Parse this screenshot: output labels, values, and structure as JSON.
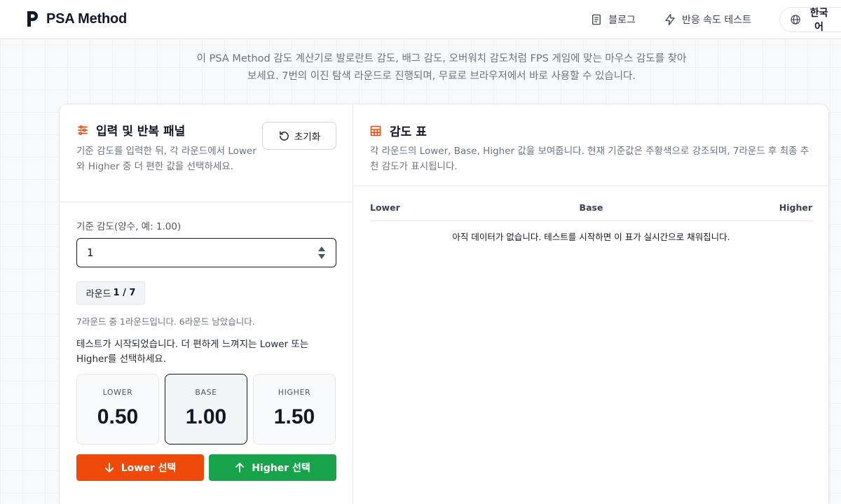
{
  "header": {
    "brand": "PSA Method",
    "nav": {
      "blog": "블로그",
      "reaction_test": "반응 속도 테스트",
      "language": "한국어"
    }
  },
  "intro": {
    "line1": "이 PSA Method 감도 계산기로 발로란트 감도, 배그 감도, 오버워치 감도처럼 FPS 게임에 맞는 마우스 감도를 찾아",
    "line2": "보세요. 7번의 이진 탐색 라운드로 진행되며, 무료로 브라우저에서 바로 사용할 수 있습니다."
  },
  "panel": {
    "title": "입력 및 반복 패널",
    "description": "기준 감도를 입력한 뒤, 각 라운드에서 Lower와 Higher 중 더 편한 값을 선택하세요.",
    "reset_label": "초기화",
    "input_label": "기준 감도(양수, 예: 1.00)",
    "input_value": "1",
    "round_prefix": "라운드",
    "round_value": "1 / 7",
    "round_info": "7라운드 중 1라운드입니다. 6라운드 남았습니다.",
    "status": "테스트가 시작되었습니다. 더 편하게 느껴지는 Lower 또는 Higher를 선택하세요.",
    "options": {
      "lower": {
        "label": "LOWER",
        "value": "0.50"
      },
      "base": {
        "label": "BASE",
        "value": "1.00"
      },
      "higher": {
        "label": "HIGHER",
        "value": "1.50"
      }
    },
    "choose_lower": "Lower 선택",
    "choose_higher": "Higher 선택"
  },
  "table": {
    "title": "감도 표",
    "description": "각 라운드의 Lower, Base, Higher 값을 보여줍니다. 현재 기준값은 주황색으로 강조되며, 7라운드 후 최종 추천 감도가 표시됩니다.",
    "columns": {
      "lower": "Lower",
      "base": "Base",
      "higher": "Higher"
    },
    "empty": "아직 데이터가 없습니다. 테스트를 시작하면 이 표가 실시간으로 채워집니다."
  },
  "colors": {
    "accent_orange": "#f04a0a",
    "accent_green": "#16a34a",
    "text_dark": "#111827",
    "text_muted": "#6b7280"
  },
  "icons": {
    "brand": "brand-p-logo-icon",
    "blog": "document-icon",
    "reaction": "lightning-icon",
    "language": "globe-icon",
    "panel": "sliders-icon",
    "reset": "rotate-ccw-icon",
    "table": "table-grid-icon",
    "lower": "arrow-down-icon",
    "higher": "arrow-up-icon"
  }
}
